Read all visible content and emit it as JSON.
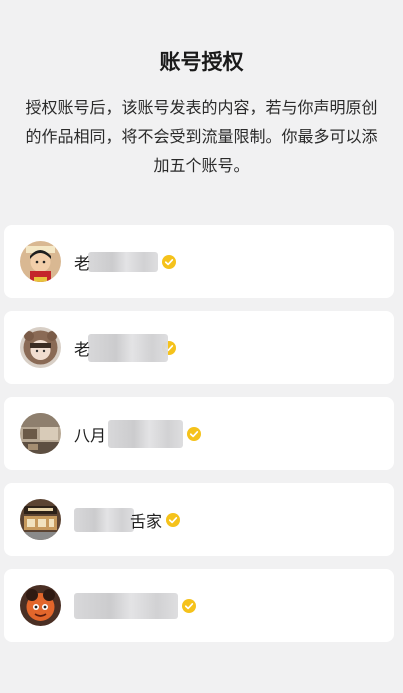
{
  "header": {
    "title": "账号授权",
    "description": "授权账号后，该账号发表的内容，若与你声明原创的作品相同，将不会受到流量限制。你最多可以添加五个账号。"
  },
  "accounts": [
    {
      "name_prefix": "老",
      "name_suffix": "",
      "verified": true,
      "avatar": "cartoon-boy-avatar"
    },
    {
      "name_prefix": "老",
      "name_suffix": "",
      "verified": true,
      "avatar": "girl-hood-avatar"
    },
    {
      "name_prefix": "八月",
      "name_suffix": "",
      "verified": true,
      "avatar": "shop-interior-avatar"
    },
    {
      "name_prefix": "",
      "name_suffix": "舌家",
      "verified": true,
      "avatar": "storefront-avatar"
    },
    {
      "name_prefix": "",
      "name_suffix": "",
      "verified": true,
      "avatar": "orange-cartoon-avatar"
    }
  ],
  "colors": {
    "background": "#f1f1f2",
    "card": "#ffffff",
    "verified_badge": "#f5c21b"
  }
}
